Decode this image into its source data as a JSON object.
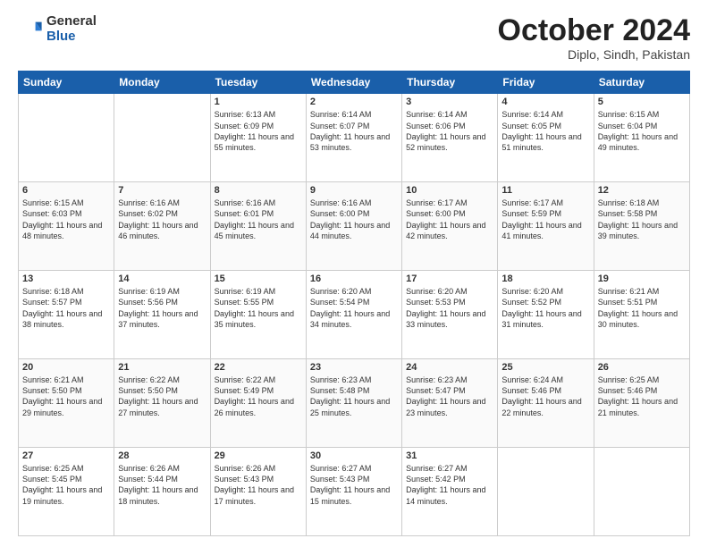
{
  "header": {
    "logo": {
      "line1": "General",
      "line2": "Blue"
    },
    "title": "October 2024",
    "location": "Diplo, Sindh, Pakistan"
  },
  "weekdays": [
    "Sunday",
    "Monday",
    "Tuesday",
    "Wednesday",
    "Thursday",
    "Friday",
    "Saturday"
  ],
  "weeks": [
    [
      {
        "day": "",
        "info": ""
      },
      {
        "day": "",
        "info": ""
      },
      {
        "day": "1",
        "info": "Sunrise: 6:13 AM\nSunset: 6:09 PM\nDaylight: 11 hours and 55 minutes."
      },
      {
        "day": "2",
        "info": "Sunrise: 6:14 AM\nSunset: 6:07 PM\nDaylight: 11 hours and 53 minutes."
      },
      {
        "day": "3",
        "info": "Sunrise: 6:14 AM\nSunset: 6:06 PM\nDaylight: 11 hours and 52 minutes."
      },
      {
        "day": "4",
        "info": "Sunrise: 6:14 AM\nSunset: 6:05 PM\nDaylight: 11 hours and 51 minutes."
      },
      {
        "day": "5",
        "info": "Sunrise: 6:15 AM\nSunset: 6:04 PM\nDaylight: 11 hours and 49 minutes."
      }
    ],
    [
      {
        "day": "6",
        "info": "Sunrise: 6:15 AM\nSunset: 6:03 PM\nDaylight: 11 hours and 48 minutes."
      },
      {
        "day": "7",
        "info": "Sunrise: 6:16 AM\nSunset: 6:02 PM\nDaylight: 11 hours and 46 minutes."
      },
      {
        "day": "8",
        "info": "Sunrise: 6:16 AM\nSunset: 6:01 PM\nDaylight: 11 hours and 45 minutes."
      },
      {
        "day": "9",
        "info": "Sunrise: 6:16 AM\nSunset: 6:00 PM\nDaylight: 11 hours and 44 minutes."
      },
      {
        "day": "10",
        "info": "Sunrise: 6:17 AM\nSunset: 6:00 PM\nDaylight: 11 hours and 42 minutes."
      },
      {
        "day": "11",
        "info": "Sunrise: 6:17 AM\nSunset: 5:59 PM\nDaylight: 11 hours and 41 minutes."
      },
      {
        "day": "12",
        "info": "Sunrise: 6:18 AM\nSunset: 5:58 PM\nDaylight: 11 hours and 39 minutes."
      }
    ],
    [
      {
        "day": "13",
        "info": "Sunrise: 6:18 AM\nSunset: 5:57 PM\nDaylight: 11 hours and 38 minutes."
      },
      {
        "day": "14",
        "info": "Sunrise: 6:19 AM\nSunset: 5:56 PM\nDaylight: 11 hours and 37 minutes."
      },
      {
        "day": "15",
        "info": "Sunrise: 6:19 AM\nSunset: 5:55 PM\nDaylight: 11 hours and 35 minutes."
      },
      {
        "day": "16",
        "info": "Sunrise: 6:20 AM\nSunset: 5:54 PM\nDaylight: 11 hours and 34 minutes."
      },
      {
        "day": "17",
        "info": "Sunrise: 6:20 AM\nSunset: 5:53 PM\nDaylight: 11 hours and 33 minutes."
      },
      {
        "day": "18",
        "info": "Sunrise: 6:20 AM\nSunset: 5:52 PM\nDaylight: 11 hours and 31 minutes."
      },
      {
        "day": "19",
        "info": "Sunrise: 6:21 AM\nSunset: 5:51 PM\nDaylight: 11 hours and 30 minutes."
      }
    ],
    [
      {
        "day": "20",
        "info": "Sunrise: 6:21 AM\nSunset: 5:50 PM\nDaylight: 11 hours and 29 minutes."
      },
      {
        "day": "21",
        "info": "Sunrise: 6:22 AM\nSunset: 5:50 PM\nDaylight: 11 hours and 27 minutes."
      },
      {
        "day": "22",
        "info": "Sunrise: 6:22 AM\nSunset: 5:49 PM\nDaylight: 11 hours and 26 minutes."
      },
      {
        "day": "23",
        "info": "Sunrise: 6:23 AM\nSunset: 5:48 PM\nDaylight: 11 hours and 25 minutes."
      },
      {
        "day": "24",
        "info": "Sunrise: 6:23 AM\nSunset: 5:47 PM\nDaylight: 11 hours and 23 minutes."
      },
      {
        "day": "25",
        "info": "Sunrise: 6:24 AM\nSunset: 5:46 PM\nDaylight: 11 hours and 22 minutes."
      },
      {
        "day": "26",
        "info": "Sunrise: 6:25 AM\nSunset: 5:46 PM\nDaylight: 11 hours and 21 minutes."
      }
    ],
    [
      {
        "day": "27",
        "info": "Sunrise: 6:25 AM\nSunset: 5:45 PM\nDaylight: 11 hours and 19 minutes."
      },
      {
        "day": "28",
        "info": "Sunrise: 6:26 AM\nSunset: 5:44 PM\nDaylight: 11 hours and 18 minutes."
      },
      {
        "day": "29",
        "info": "Sunrise: 6:26 AM\nSunset: 5:43 PM\nDaylight: 11 hours and 17 minutes."
      },
      {
        "day": "30",
        "info": "Sunrise: 6:27 AM\nSunset: 5:43 PM\nDaylight: 11 hours and 15 minutes."
      },
      {
        "day": "31",
        "info": "Sunrise: 6:27 AM\nSunset: 5:42 PM\nDaylight: 11 hours and 14 minutes."
      },
      {
        "day": "",
        "info": ""
      },
      {
        "day": "",
        "info": ""
      }
    ]
  ]
}
